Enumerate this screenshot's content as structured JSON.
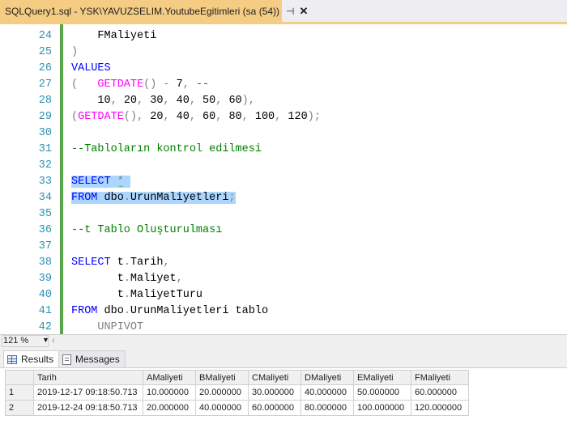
{
  "tab": {
    "title": "SQLQuery1.sql - YSK\\YAVUZSELIM.YoutubeEgitimleri (sa (54))",
    "pin_icon": "pin-icon",
    "close_icon": "close-icon"
  },
  "editor": {
    "lines": [
      {
        "n": "24",
        "segments": [
          {
            "t": "    FMaliyeti",
            "c": "tx"
          }
        ]
      },
      {
        "n": "25",
        "segments": [
          {
            "t": ")",
            "c": "gray"
          }
        ]
      },
      {
        "n": "26",
        "segments": [
          {
            "t": "VALUES",
            "c": "kw"
          }
        ]
      },
      {
        "n": "27",
        "segments": [
          {
            "t": "(   ",
            "c": "gray"
          },
          {
            "t": "GETDATE",
            "c": "fn"
          },
          {
            "t": "()",
            "c": "gray"
          },
          {
            "t": " ",
            "c": "tx"
          },
          {
            "t": "-",
            "c": "gray"
          },
          {
            "t": " 7",
            "c": "tx"
          },
          {
            "t": ",",
            "c": "gray"
          },
          {
            "t": " --",
            "c": "cm"
          }
        ]
      },
      {
        "n": "28",
        "segments": [
          {
            "t": "    10",
            "c": "tx"
          },
          {
            "t": ", ",
            "c": "gray"
          },
          {
            "t": "20",
            "c": "tx"
          },
          {
            "t": ", ",
            "c": "gray"
          },
          {
            "t": "30",
            "c": "tx"
          },
          {
            "t": ", ",
            "c": "gray"
          },
          {
            "t": "40",
            "c": "tx"
          },
          {
            "t": ", ",
            "c": "gray"
          },
          {
            "t": "50",
            "c": "tx"
          },
          {
            "t": ", ",
            "c": "gray"
          },
          {
            "t": "60",
            "c": "tx"
          },
          {
            "t": "),",
            "c": "gray"
          }
        ]
      },
      {
        "n": "29",
        "segments": [
          {
            "t": "(",
            "c": "gray"
          },
          {
            "t": "GETDATE",
            "c": "fn"
          },
          {
            "t": "(), ",
            "c": "gray"
          },
          {
            "t": "20",
            "c": "tx"
          },
          {
            "t": ", ",
            "c": "gray"
          },
          {
            "t": "40",
            "c": "tx"
          },
          {
            "t": ", ",
            "c": "gray"
          },
          {
            "t": "60",
            "c": "tx"
          },
          {
            "t": ", ",
            "c": "gray"
          },
          {
            "t": "80",
            "c": "tx"
          },
          {
            "t": ", ",
            "c": "gray"
          },
          {
            "t": "100",
            "c": "tx"
          },
          {
            "t": ", ",
            "c": "gray"
          },
          {
            "t": "120",
            "c": "tx"
          },
          {
            "t": ");",
            "c": "gray"
          }
        ]
      },
      {
        "n": "30",
        "segments": []
      },
      {
        "n": "31",
        "segments": [
          {
            "t": "--Tabloların kontrol edilmesi",
            "c": "cm"
          }
        ]
      },
      {
        "n": "32",
        "segments": []
      },
      {
        "n": "33",
        "segments": [
          {
            "t": "SELECT",
            "c": "kw sel"
          },
          {
            "t": " ",
            "c": "tx sel"
          },
          {
            "t": "*",
            "c": "gray sel"
          },
          {
            "t": " ",
            "c": "tx sel"
          }
        ]
      },
      {
        "n": "34",
        "segments": [
          {
            "t": "FROM",
            "c": "kw sel"
          },
          {
            "t": " dbo",
            "c": "tx sel"
          },
          {
            "t": ".",
            "c": "gray sel"
          },
          {
            "t": "UrunMaliyetleri",
            "c": "tx sel"
          },
          {
            "t": ";",
            "c": "gray sel"
          }
        ]
      },
      {
        "n": "35",
        "segments": []
      },
      {
        "n": "36",
        "segments": [
          {
            "t": "--t Tablo Oluşturulması",
            "c": "cm"
          }
        ]
      },
      {
        "n": "37",
        "segments": []
      },
      {
        "n": "38",
        "segments": [
          {
            "t": "SELECT",
            "c": "kw"
          },
          {
            "t": " t",
            "c": "tx"
          },
          {
            "t": ".",
            "c": "gray"
          },
          {
            "t": "Tarih",
            "c": "tx"
          },
          {
            "t": ",",
            "c": "gray"
          }
        ]
      },
      {
        "n": "39",
        "segments": [
          {
            "t": "       t",
            "c": "tx"
          },
          {
            "t": ".",
            "c": "gray"
          },
          {
            "t": "Maliyet",
            "c": "tx"
          },
          {
            "t": ",",
            "c": "gray"
          }
        ]
      },
      {
        "n": "40",
        "segments": [
          {
            "t": "       t",
            "c": "tx"
          },
          {
            "t": ".",
            "c": "gray"
          },
          {
            "t": "MaliyetTuru",
            "c": "tx"
          }
        ]
      },
      {
        "n": "41",
        "segments": [
          {
            "t": "FROM",
            "c": "kw"
          },
          {
            "t": " dbo",
            "c": "tx"
          },
          {
            "t": ".",
            "c": "gray"
          },
          {
            "t": "UrunMaliyetleri tablo",
            "c": "tx"
          }
        ]
      },
      {
        "n": "42",
        "segments": [
          {
            "t": "    UNPIVOT",
            "c": "gray"
          }
        ]
      }
    ]
  },
  "status": {
    "zoom": "121 %"
  },
  "results": {
    "tabs": [
      {
        "label": "Results",
        "icon": "grid-icon"
      },
      {
        "label": "Messages",
        "icon": "messages-icon"
      }
    ],
    "columns": [
      "",
      "Tarih",
      "AMaliyeti",
      "BMaliyeti",
      "CMaliyeti",
      "DMaliyeti",
      "EMaliyeti",
      "FMaliyeti"
    ],
    "rows": [
      [
        "1",
        "2019-12-17 09:18:50.713",
        "10.000000",
        "20.000000",
        "30.000000",
        "40.000000",
        "50.000000",
        "60.000000"
      ],
      [
        "2",
        "2019-12-24 09:18:50.713",
        "20.000000",
        "40.000000",
        "60.000000",
        "80.000000",
        "100.000000",
        "120.000000"
      ]
    ]
  }
}
